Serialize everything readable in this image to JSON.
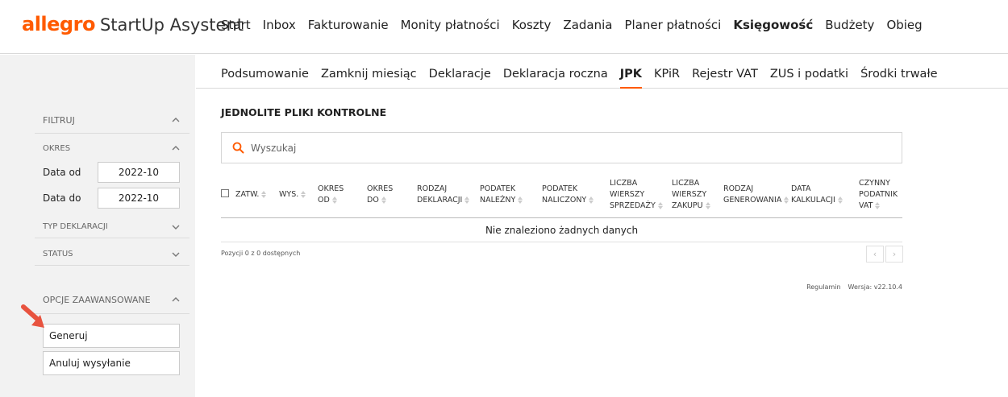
{
  "brand": {
    "logo": "allegro",
    "app_name": "StartUp Asystent"
  },
  "main_nav": [
    {
      "label": "Start",
      "active": false
    },
    {
      "label": "Inbox",
      "active": false
    },
    {
      "label": "Fakturowanie",
      "active": false
    },
    {
      "label": "Monity płatności",
      "active": false
    },
    {
      "label": "Koszty",
      "active": false
    },
    {
      "label": "Zadania",
      "active": false
    },
    {
      "label": "Planer płatności",
      "active": false
    },
    {
      "label": "Księgowość",
      "active": true
    },
    {
      "label": "Budżety",
      "active": false
    },
    {
      "label": "Obieg",
      "active": false
    }
  ],
  "sub_nav": [
    {
      "label": "Podsumowanie",
      "active": false
    },
    {
      "label": "Zamknij miesiąc",
      "active": false
    },
    {
      "label": "Deklaracje",
      "active": false
    },
    {
      "label": "Deklaracja roczna",
      "active": false
    },
    {
      "label": "JPK",
      "active": true
    },
    {
      "label": "KPiR",
      "active": false
    },
    {
      "label": "Rejestr VAT",
      "active": false
    },
    {
      "label": "ZUS i podatki",
      "active": false
    },
    {
      "label": "Środki trwałe",
      "active": false
    }
  ],
  "sidebar": {
    "filter_label": "FILTRUJ",
    "period_label": "OKRES",
    "date_from_label": "Data od",
    "date_from_value": "2022-10",
    "date_to_label": "Data do",
    "date_to_value": "2022-10",
    "declaration_type_label": "TYP DEKLARACJI",
    "status_label": "STATUS",
    "advanced_label": "OPCJE ZAAWANSOWANE",
    "generate_button": "Generuj",
    "cancel_send_button": "Anuluj wysyłanie"
  },
  "page": {
    "title": "JEDNOLITE PLIKI KONTROLNE",
    "search_placeholder": "Wyszukaj",
    "empty_message": "Nie znaleziono żadnych danych",
    "info": "Pozycji 0 z 0 dostępnych",
    "pager_prev": "‹",
    "pager_next": "›",
    "footer_terms": "Regulamin",
    "footer_version": "Wersja: v22.10.4"
  },
  "table": {
    "columns": [
      {
        "lines": [
          "ZATW."
        ]
      },
      {
        "lines": [
          "WYS."
        ]
      },
      {
        "lines": [
          "OKRES",
          "OD"
        ]
      },
      {
        "lines": [
          "OKRES",
          "DO"
        ]
      },
      {
        "lines": [
          "RODZAJ",
          "DEKLARACJI"
        ]
      },
      {
        "lines": [
          "PODATEK",
          "NALEŻNY"
        ]
      },
      {
        "lines": [
          "PODATEK",
          "NALICZONY"
        ]
      },
      {
        "lines": [
          "LICZBA",
          "WIERSZY",
          "SPRZEDAŻY"
        ]
      },
      {
        "lines": [
          "LICZBA",
          "WIERSZY",
          "ZAKUPU"
        ]
      },
      {
        "lines": [
          "RODZAJ",
          "GENEROWANIA"
        ]
      },
      {
        "lines": [
          "DATA",
          "KALKULACJI"
        ]
      },
      {
        "lines": [
          "CZYNNY",
          "PODATNIK",
          "VAT"
        ]
      }
    ]
  },
  "colors": {
    "accent": "#ff5a00",
    "arrow": "#e8533f"
  }
}
